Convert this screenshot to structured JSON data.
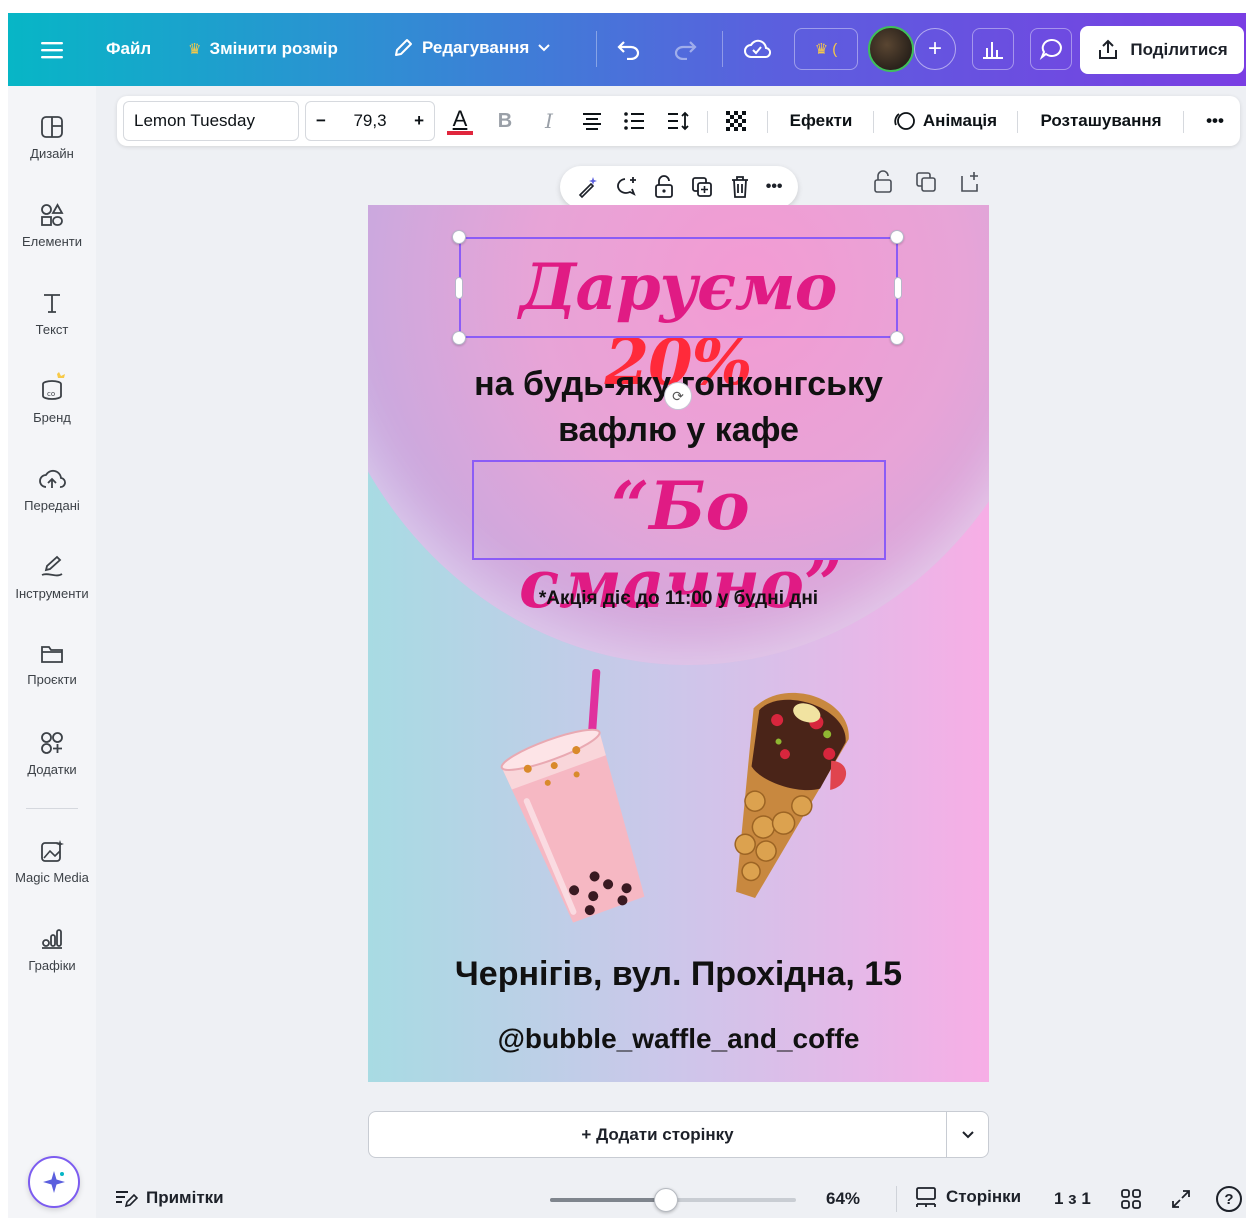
{
  "topbar": {
    "file_label": "Файл",
    "resize_label": "Змінити розмір",
    "edit_label": "Редагування",
    "share_label": "Поділитися",
    "accent_color": "#7a3ee3"
  },
  "sidebar": {
    "items": [
      {
        "label": "Дизайн",
        "icon": "layout-icon"
      },
      {
        "label": "Елементи",
        "icon": "shapes-icon"
      },
      {
        "label": "Текст",
        "icon": "text-icon"
      },
      {
        "label": "Бренд",
        "icon": "brand-icon"
      },
      {
        "label": "Передані",
        "icon": "upload-cloud-icon"
      },
      {
        "label": "Інструменти",
        "icon": "draw-icon"
      },
      {
        "label": "Проєкти",
        "icon": "folder-icon"
      },
      {
        "label": "Додатки",
        "icon": "apps-icon"
      },
      {
        "label": "Magic Media",
        "icon": "magic-media-icon"
      },
      {
        "label": "Графіки",
        "icon": "charts-icon"
      }
    ]
  },
  "format_toolbar": {
    "font_name": "Lemon Tuesday",
    "font_size": "79,3",
    "minus": "−",
    "plus": "+",
    "text_color_letter": "A",
    "bold": "B",
    "italic": "I",
    "effects_label": "Ефекти",
    "animation_label": "Анімація",
    "position_label": "Розташування",
    "more": "•••",
    "text_color_swatch": "#e0263d"
  },
  "design": {
    "headline": "Даруємо",
    "headline_pct": "20%",
    "subline_1": "на будь-яку гонконгську",
    "subline_2": "вафлю у кафе",
    "cafe_name": "“Бо смачно”",
    "promo_note": "*Акція діє до 11:00 у будні дні",
    "address": "Чернігів, вул. Прохідна, 15",
    "handle": "@bubble_waffle_and_coffe",
    "pink_color": "#e01b84"
  },
  "bottom": {
    "add_page_label": "+ Додати сторінку",
    "notes_label": "Примітки",
    "zoom_value": "64%",
    "zoom_fraction": 0.47,
    "pages_label": "Сторінки",
    "page_counter": "1 з 1",
    "help": "?"
  }
}
